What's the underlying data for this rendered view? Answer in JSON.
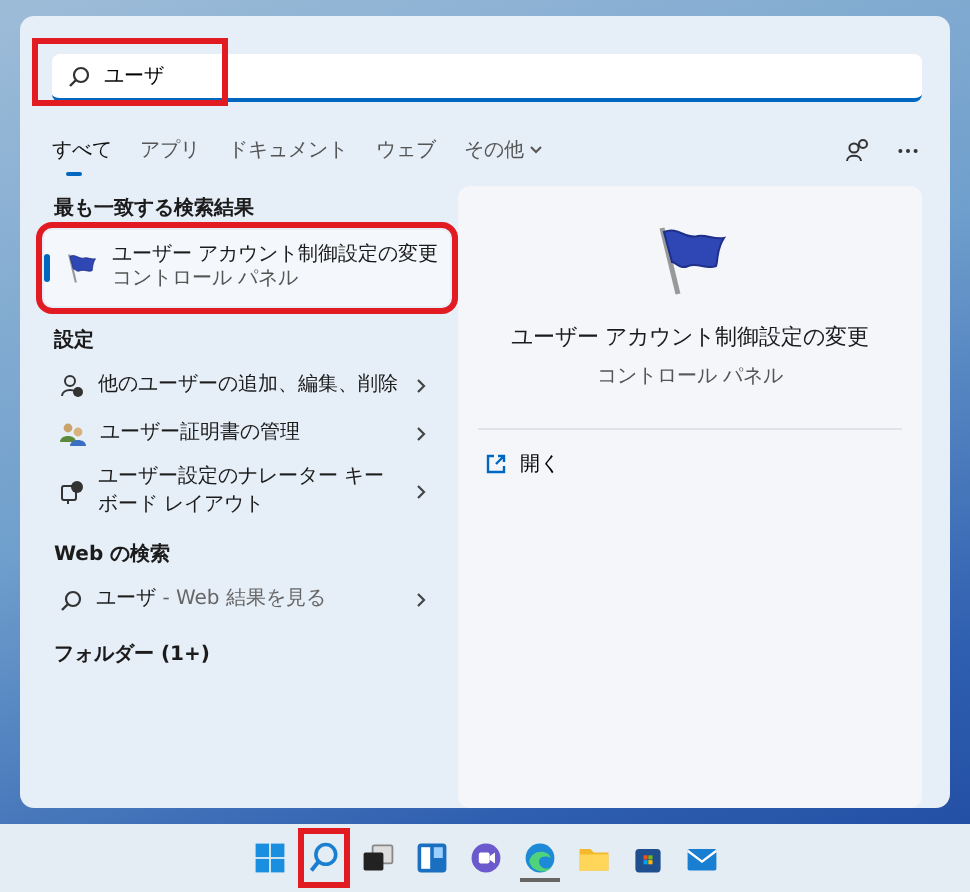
{
  "search": {
    "value": "ユーザ",
    "highlighted": true
  },
  "tabs": [
    {
      "label": "すべて",
      "selected": true,
      "dropdown": false
    },
    {
      "label": "アプリ",
      "selected": false,
      "dropdown": false
    },
    {
      "label": "ドキュメント",
      "selected": false,
      "dropdown": false
    },
    {
      "label": "ウェブ",
      "selected": false,
      "dropdown": false
    },
    {
      "label": "その他",
      "selected": false,
      "dropdown": true
    }
  ],
  "best_match": {
    "heading": "最も一致する検索結果",
    "title": "ユーザー アカウント制御設定の変更",
    "subtitle": "コントロール パネル",
    "selected": true,
    "highlighted": true
  },
  "settings": {
    "heading": "設定",
    "items": [
      {
        "label": "他のユーザーの追加、編集、削除",
        "kind": "user-add"
      },
      {
        "label": "ユーザー証明書の管理",
        "kind": "certificate"
      },
      {
        "label": "ユーザー設定のナレーター キーボード レイアウト",
        "kind": "narrator"
      }
    ]
  },
  "web": {
    "heading": "Web の検索",
    "items": [
      {
        "query": "ユーザ",
        "hint": "- Web 結果を見る"
      }
    ]
  },
  "folders": {
    "heading": "フォルダー (1+)"
  },
  "preview": {
    "title": "ユーザー アカウント制御設定の変更",
    "subtitle": "コントロール パネル",
    "actions": [
      {
        "label": "開く"
      }
    ]
  },
  "taskbar": [
    {
      "kind": "start",
      "highlighted": false,
      "running": false
    },
    {
      "kind": "search",
      "highlighted": true,
      "running": false
    },
    {
      "kind": "taskview",
      "highlighted": false,
      "running": false
    },
    {
      "kind": "widgets",
      "highlighted": false,
      "running": false
    },
    {
      "kind": "chat",
      "highlighted": false,
      "running": false
    },
    {
      "kind": "edge",
      "highlighted": false,
      "running": true
    },
    {
      "kind": "folder",
      "highlighted": false,
      "running": false
    },
    {
      "kind": "store",
      "highlighted": false,
      "running": false
    },
    {
      "kind": "mail",
      "highlighted": false,
      "running": false
    }
  ]
}
